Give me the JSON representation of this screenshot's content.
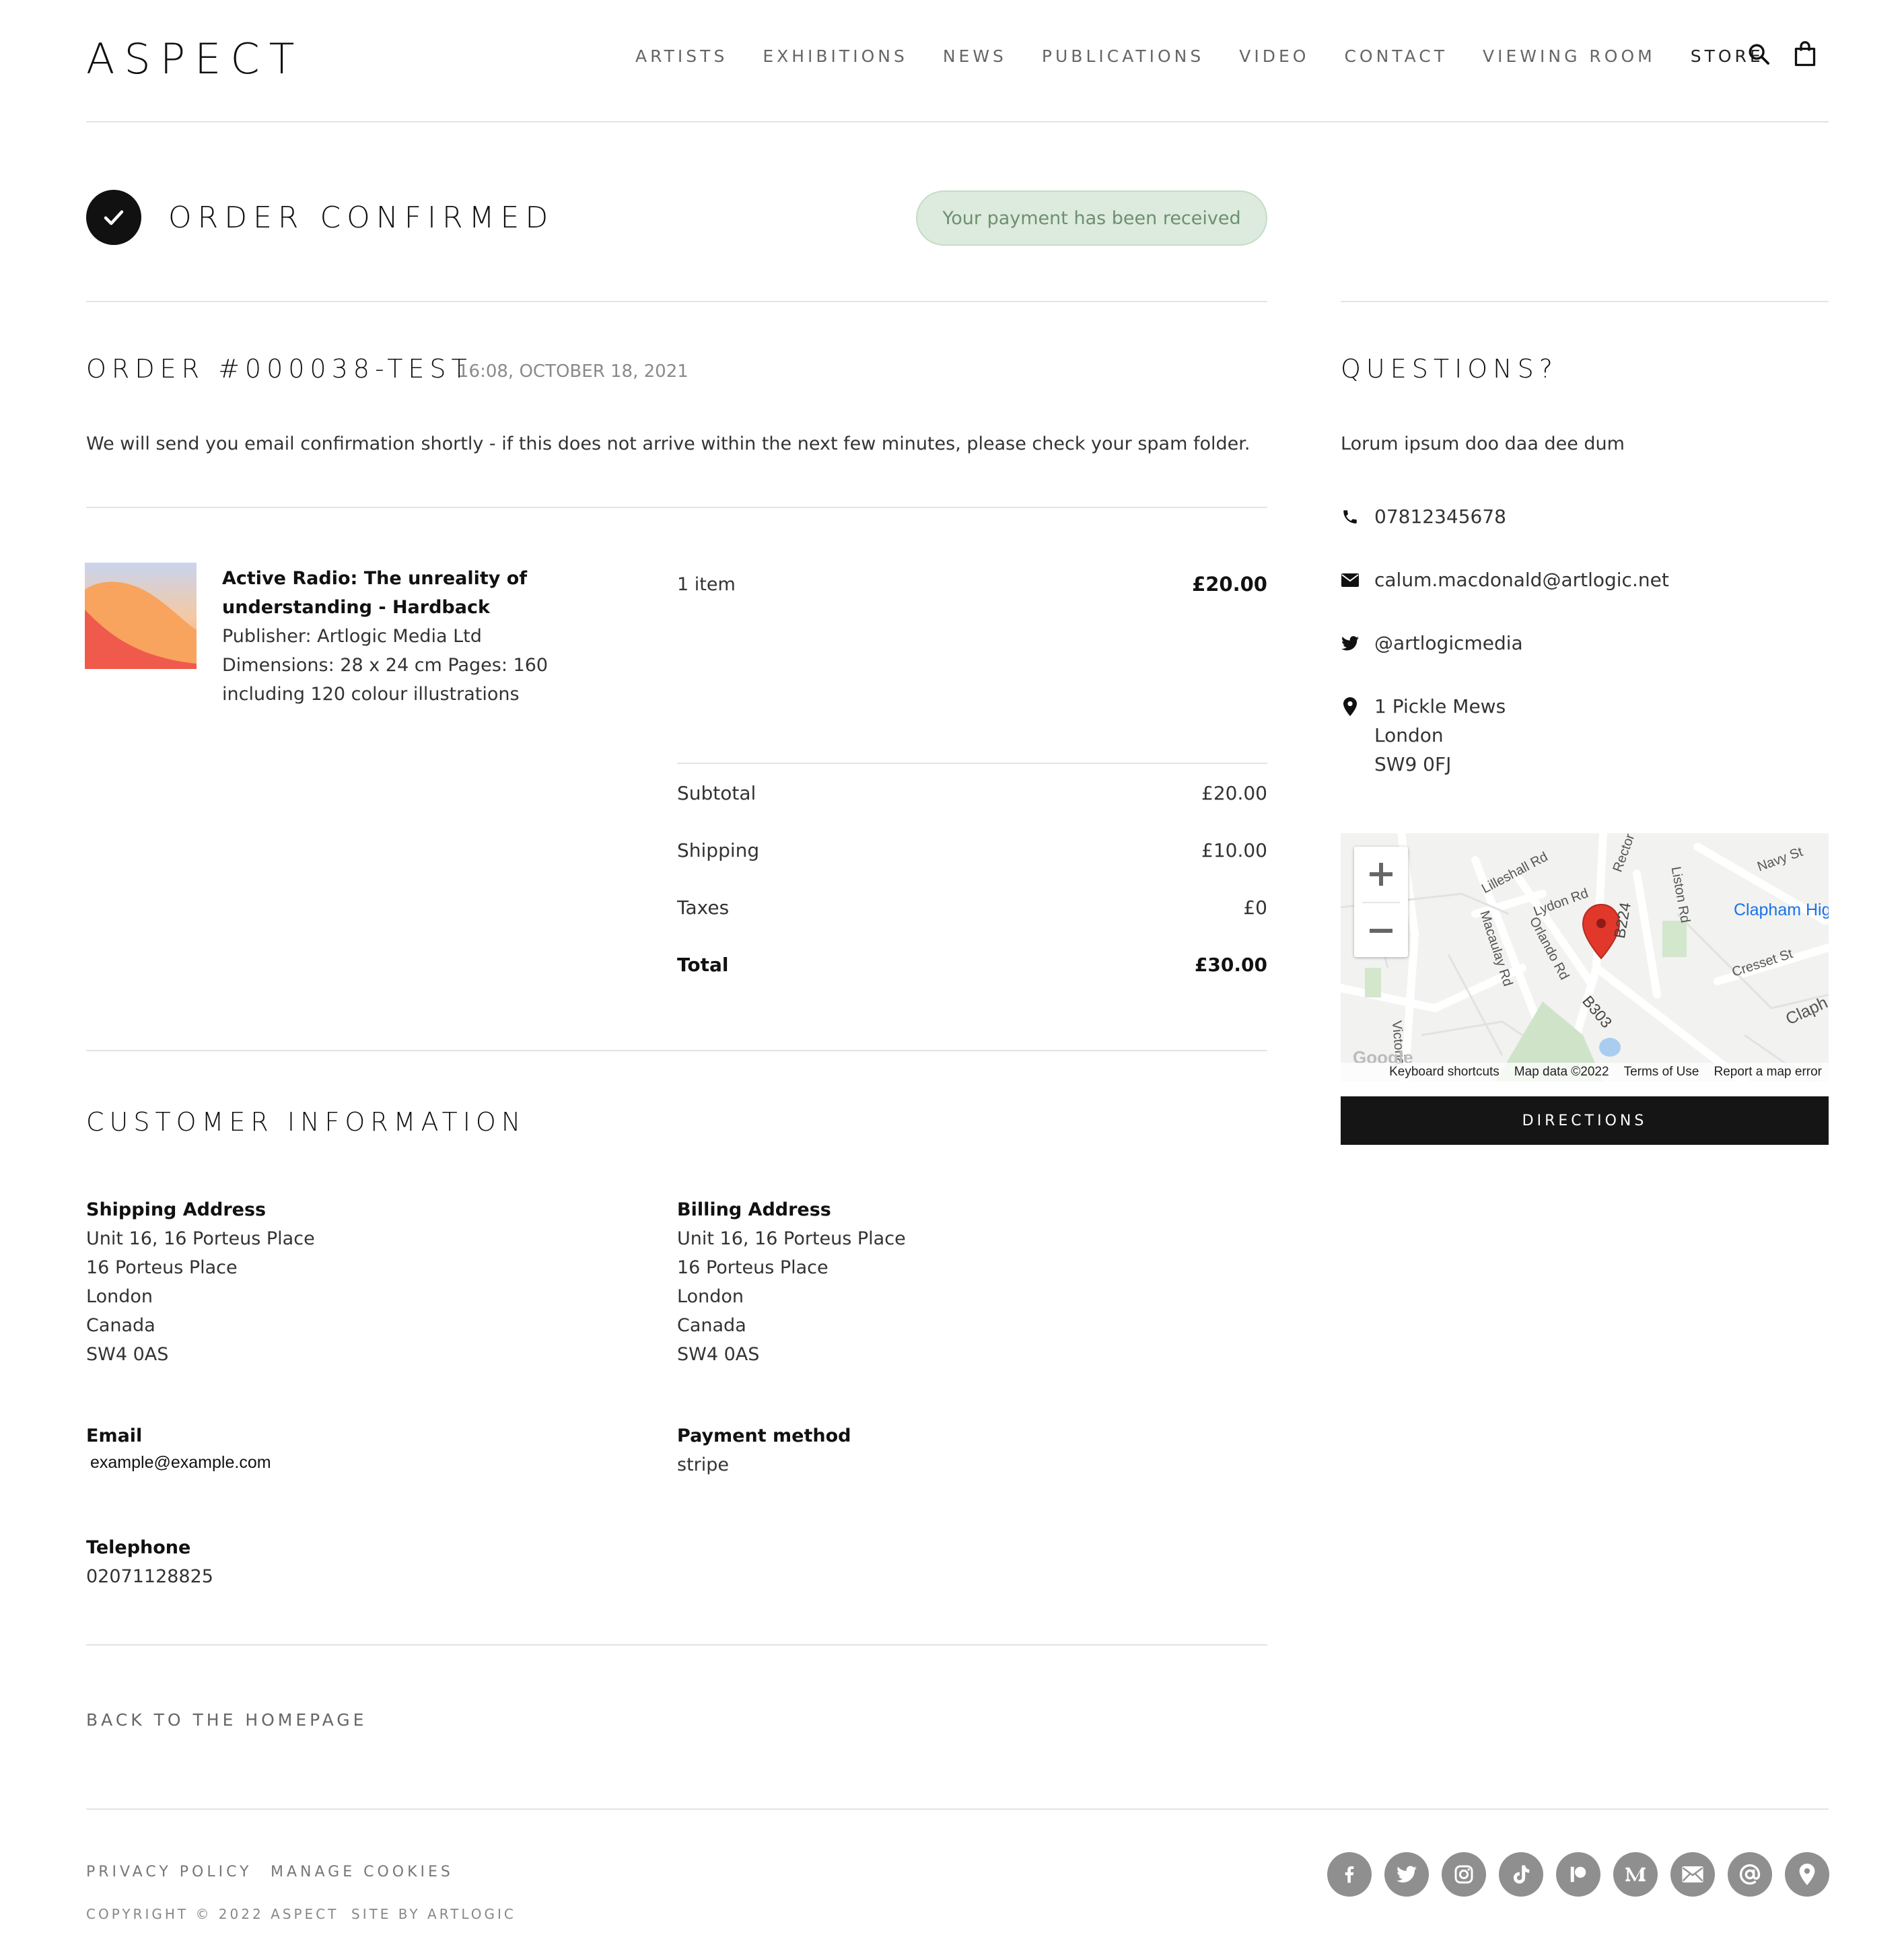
{
  "header": {
    "logo": "ASPECT",
    "nav": [
      "ARTISTS",
      "EXHIBITIONS",
      "NEWS",
      "PUBLICATIONS",
      "VIDEO",
      "CONTACT",
      "VIEWING ROOM",
      "STORE"
    ]
  },
  "status": {
    "title": "ORDER CONFIRMED",
    "payment_pill": "Your payment has been received",
    "pill_color": "#dcebdd"
  },
  "order": {
    "number": "ORDER #000038-TEST",
    "date": "16:08, OCTOBER 18, 2021",
    "confirmation_text": "We will send you email confirmation shortly - if this does not arrive within the next few minutes, please check your spam folder."
  },
  "item": {
    "title_line1": "Active Radio: The unreality of",
    "title_line2": "understanding - Hardback",
    "publisher": "Publisher: Artlogic Media Ltd",
    "dimensions_line1": "Dimensions: 28 x 24 cm Pages: 160",
    "dimensions_line2": "including 120 colour illustrations",
    "quantity": "1 item",
    "price": "£20.00"
  },
  "summary": {
    "subtotal_label": "Subtotal",
    "subtotal": "£20.00",
    "shipping_label": "Shipping",
    "shipping": "£10.00",
    "taxes_label": "Taxes",
    "taxes": "£0",
    "total_label": "Total",
    "total": "£30.00"
  },
  "customer": {
    "heading": "CUSTOMER INFORMATION",
    "shipping_label": "Shipping Address",
    "shipping_lines": [
      "Unit 16, 16 Porteus Place",
      "16 Porteus Place",
      "London",
      "Canada",
      "SW4 0AS"
    ],
    "billing_label": "Billing Address",
    "billing_lines": [
      "Unit 16, 16 Porteus Place",
      "16 Porteus Place",
      "London",
      "Canada",
      "SW4 0AS"
    ],
    "email_label": "Email",
    "email": "example@example.com",
    "payment_label": "Payment method",
    "payment": "stripe",
    "telephone_label": "Telephone",
    "telephone": "02071128825"
  },
  "back_link": "BACK TO THE HOMEPAGE",
  "sidebar": {
    "heading": "QUESTIONS?",
    "text": "Lorum ipsum doo daa dee dum",
    "phone": "07812345678",
    "email": "calum.macdonald@artlogic.net",
    "twitter": "@artlogicmedia",
    "address_lines": [
      "1 Pickle Mews",
      "London",
      "SW9 0FJ"
    ],
    "map": {
      "attribution": [
        "Keyboard shortcuts",
        "Map data ©2022",
        "Terms of Use",
        "Report a map error"
      ],
      "labels": {
        "lilleshall": "Lilleshall Rd",
        "lydon": "Lydon Rd",
        "orlando": "Orlando Rd",
        "macaulay": "Macaulay Rd",
        "liston": "Liston Rd",
        "rectory": "Rector",
        "navy": "Navy St",
        "clapham_high": "Clapham Hig",
        "cresset": "Cresset St",
        "b303": "B303",
        "b224": "B224",
        "victoria": "Victoria",
        "clapham": "Claph",
        "google": "Google"
      }
    },
    "directions": "DIRECTIONS"
  },
  "footer": {
    "privacy": "PRIVACY POLICY",
    "cookies": "MANAGE COOKIES",
    "copyright": "COPYRIGHT © 2022 ASPECT",
    "site_by": "SITE BY ARTLOGIC",
    "social_icons": [
      "facebook-icon",
      "twitter-icon",
      "instagram-icon",
      "tiktok-icon",
      "patreon-icon",
      "medium-icon",
      "mail-icon",
      "at-icon",
      "location-icon"
    ]
  }
}
